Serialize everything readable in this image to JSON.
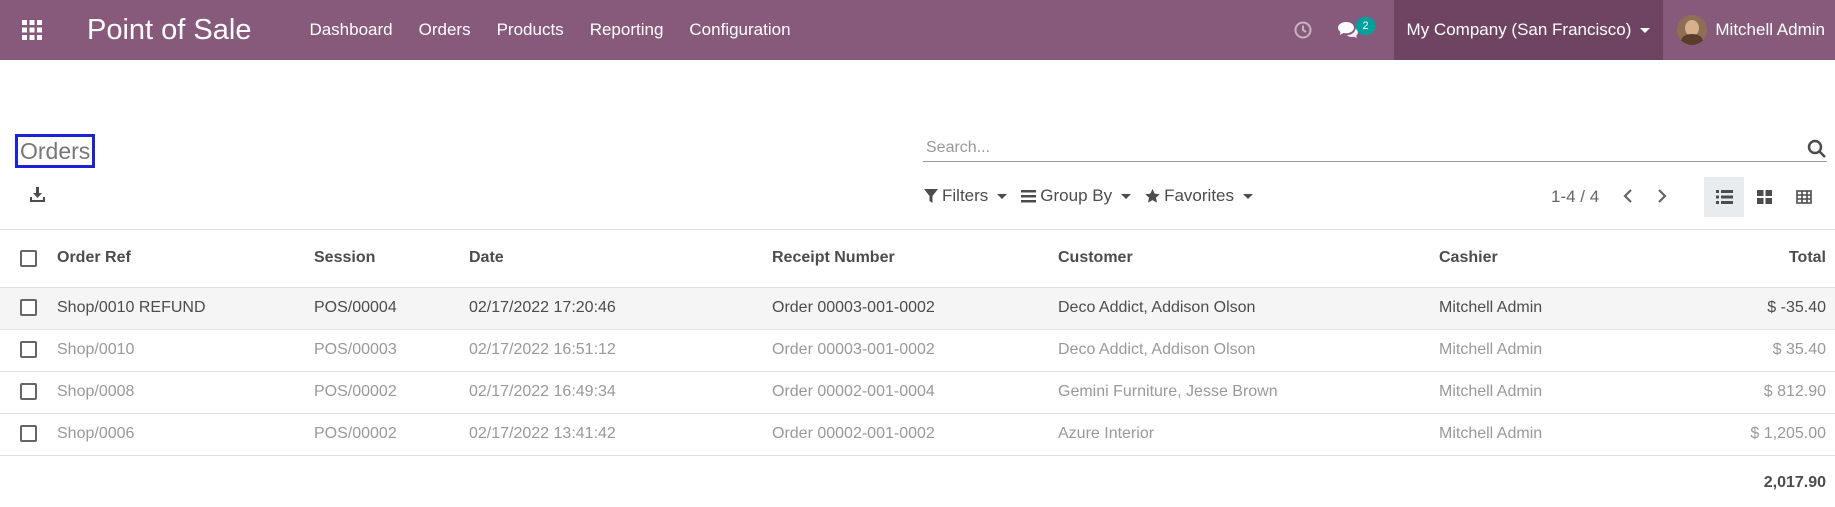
{
  "navbar": {
    "brand": "Point of Sale",
    "menu": [
      "Dashboard",
      "Orders",
      "Products",
      "Reporting",
      "Configuration"
    ],
    "chat_count": "2",
    "company": "My Company (San Francisco)",
    "user": "Mitchell Admin",
    "icons": [
      "apps-grid-icon",
      "clock-icon",
      "chat-icon"
    ],
    "bg_color": "#875a7b"
  },
  "control_panel": {
    "title": "Orders",
    "search_placeholder": "Search...",
    "filters_label": "Filters",
    "group_by_label": "Group By",
    "favorites_label": "Favorites",
    "pager": "1-4 / 4"
  },
  "table": {
    "headers": [
      "Order Ref",
      "Session",
      "Date",
      "Receipt Number",
      "Customer",
      "Cashier",
      "Total"
    ],
    "rows": [
      [
        "Shop/0010 REFUND",
        "POS/00004",
        "02/17/2022 17:20:46",
        "Order 00003-001-0002",
        "Deco Addict, Addison Olson",
        "Mitchell Admin",
        "$ -35.40"
      ],
      [
        "Shop/0010",
        "POS/00003",
        "02/17/2022 16:51:12",
        "Order 00003-001-0002",
        "Deco Addict, Addison Olson",
        "Mitchell Admin",
        "$ 35.40"
      ],
      [
        "Shop/0008",
        "POS/00002",
        "02/17/2022 16:49:34",
        "Order 00002-001-0004",
        "Gemini Furniture, Jesse Brown",
        "Mitchell Admin",
        "$ 812.90"
      ],
      [
        "Shop/0006",
        "POS/00002",
        "02/17/2022 13:41:42",
        "Order 00002-001-0002",
        "Azure Interior",
        "Mitchell Admin",
        "$ 1,205.00"
      ]
    ],
    "total": "2,017.90"
  }
}
